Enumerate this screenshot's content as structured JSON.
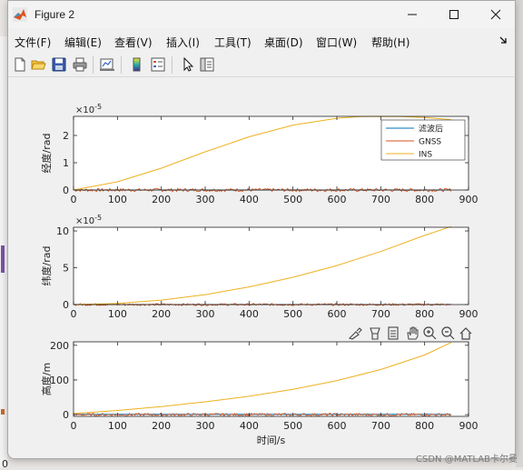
{
  "window": {
    "title": "Figure 2"
  },
  "menu": [
    {
      "label": "文件(F)"
    },
    {
      "label": "编辑(E)"
    },
    {
      "label": "查看(V)"
    },
    {
      "label": "插入(I)"
    },
    {
      "label": "工具(T)"
    },
    {
      "label": "桌面(D)"
    },
    {
      "label": "窗口(W)"
    },
    {
      "label": "帮助(H)"
    }
  ],
  "toolbar": [
    "new-figure-icon",
    "open-icon",
    "save-icon",
    "print-icon",
    "link-plot-icon",
    "colorbar-icon",
    "legend-icon",
    "pointer-icon",
    "property-inspector-icon"
  ],
  "axes_toolbar": [
    "brush-icon",
    "data-tips-icon",
    "restore-view-icon",
    "pan-icon",
    "zoom-in-icon",
    "zoom-out-icon",
    "home-icon"
  ],
  "colors": {
    "filtered": "#0072BD",
    "gnss": "#D95319",
    "ins": "#EDB120"
  },
  "background": {
    "left_tick_label": "0"
  },
  "watermark": "CSDN @MATLAB卡尔曼",
  "chart_data": [
    {
      "type": "line",
      "ylabel": "经度/rad",
      "exponent": "×10",
      "exponent_power": "-5",
      "xlim": [
        0,
        900
      ],
      "ylim": [
        0,
        2.7
      ],
      "xticks": [
        0,
        100,
        200,
        300,
        400,
        500,
        600,
        700,
        800,
        900
      ],
      "yticks": [
        0,
        1,
        2
      ],
      "legend": {
        "placement": "top-right",
        "entries": [
          "滤波后",
          "GNSS",
          "INS"
        ]
      },
      "series": [
        {
          "name": "滤波后",
          "kind": "flat",
          "x": [
            0,
            860
          ],
          "y": [
            0,
            0
          ]
        },
        {
          "name": "GNSS",
          "kind": "noise",
          "x": [
            0,
            860
          ],
          "amplitude": 0.06
        },
        {
          "name": "INS",
          "x": [
            0,
            100,
            200,
            300,
            400,
            500,
            600,
            650,
            700,
            750,
            800,
            860
          ],
          "y": [
            0,
            0.3,
            0.8,
            1.4,
            1.95,
            2.38,
            2.63,
            2.69,
            2.7,
            2.69,
            2.66,
            2.58
          ]
        }
      ]
    },
    {
      "type": "line",
      "ylabel": "纬度/rad",
      "exponent": "×10",
      "exponent_power": "-5",
      "xlim": [
        0,
        900
      ],
      "ylim": [
        0,
        10.5
      ],
      "xticks": [
        0,
        100,
        200,
        300,
        400,
        500,
        600,
        700,
        800,
        900
      ],
      "yticks": [
        0,
        5,
        10
      ],
      "series": [
        {
          "name": "滤波后",
          "kind": "flat",
          "x": [
            0,
            860
          ],
          "y": [
            0,
            0
          ]
        },
        {
          "name": "GNSS",
          "kind": "noise",
          "x": [
            0,
            860
          ],
          "amplitude": 0.15
        },
        {
          "name": "INS",
          "x": [
            0,
            100,
            200,
            300,
            400,
            500,
            600,
            700,
            800,
            860
          ],
          "y": [
            0,
            0.15,
            0.6,
            1.35,
            2.4,
            3.7,
            5.3,
            7.2,
            9.4,
            10.6
          ]
        }
      ]
    },
    {
      "type": "line",
      "ylabel": "高度/m",
      "xlabel": "时间/s",
      "xlim": [
        0,
        900
      ],
      "ylim": [
        -5,
        210
      ],
      "xticks": [
        0,
        100,
        200,
        300,
        400,
        500,
        600,
        700,
        800,
        900
      ],
      "yticks": [
        0,
        100,
        200
      ],
      "series": [
        {
          "name": "滤波后",
          "kind": "flat",
          "x": [
            0,
            860
          ],
          "y": [
            1,
            1
          ]
        },
        {
          "name": "GNSS",
          "kind": "noise",
          "x": [
            0,
            860
          ],
          "amplitude": 4
        },
        {
          "name": "INS",
          "x": [
            0,
            100,
            200,
            300,
            400,
            500,
            600,
            700,
            800,
            860
          ],
          "y": [
            3,
            12,
            23,
            37,
            53,
            73,
            98,
            130,
            172,
            208
          ]
        }
      ]
    }
  ]
}
